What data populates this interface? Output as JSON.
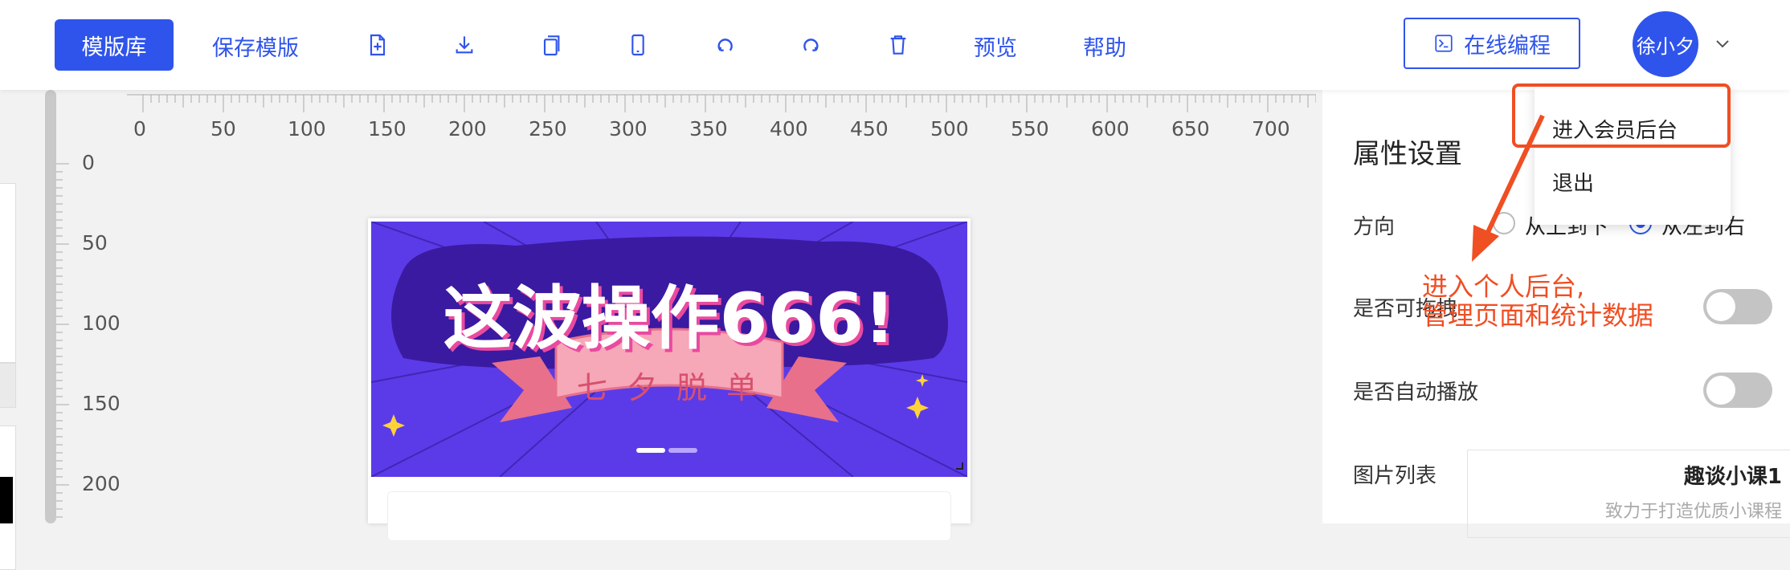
{
  "toolbar": {
    "template_lib": "模版库",
    "save_template": "保存模版",
    "preview": "预览",
    "help": "帮助",
    "icons": [
      "new-page-icon",
      "download-icon",
      "copy-icon",
      "mobile-icon",
      "undo-icon",
      "redo-icon",
      "delete-icon"
    ],
    "online_code": "在线编程",
    "user_name": "徐小夕",
    "accent": "#2f54eb"
  },
  "ruler": {
    "h_ticks": [
      "0",
      "50",
      "100",
      "150",
      "200",
      "250",
      "300",
      "350",
      "400",
      "450",
      "500",
      "550",
      "600",
      "650",
      "700"
    ],
    "v_ticks": [
      "0",
      "50",
      "100",
      "150",
      "200"
    ]
  },
  "banner": {
    "headline": "这波操作666!",
    "ribbon": "七 夕 脱 单"
  },
  "panel": {
    "title": "属性设置",
    "direction_label": "方向",
    "direction_opt1": "从上到下",
    "direction_opt2": "从左到右",
    "draggable_label": "是否可拖拽",
    "autoplay_label": "是否自动播放",
    "image_list_label": "图片列表",
    "image_item_title": "趣谈小课1",
    "image_item_desc": "致力于打造优质小课程"
  },
  "user_menu": {
    "enter_admin": "进入会员后台",
    "logout": "退出"
  },
  "annotation": {
    "line1": "进入个人后台,",
    "line2": "管理页面和统计数据",
    "color": "#f04e23"
  }
}
